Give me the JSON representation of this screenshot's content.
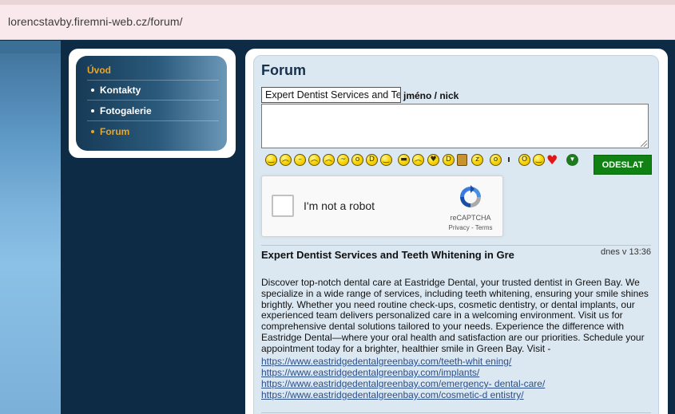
{
  "browser": {
    "url": "lorencstavby.firemni-web.cz/forum/"
  },
  "nav": {
    "home": "Úvod",
    "items": [
      {
        "label": "Kontakty",
        "active": false
      },
      {
        "label": "Fotogalerie",
        "active": false
      },
      {
        "label": "Forum",
        "active": true
      }
    ]
  },
  "forum": {
    "title": "Forum",
    "name_value": "Expert Dentist Services and Teeth Whitening in Gre",
    "name_label": "jméno / nick",
    "message_value": "",
    "send_label": "ODESLAT",
    "smileys": [
      "smile",
      "sad",
      "neutral",
      "worried",
      "crying",
      "confused",
      "surprised",
      "laughing",
      "grin",
      "cool",
      "angry",
      "love-eyes",
      "big-grin",
      "beer-mug",
      "sleepy",
      "whistle",
      "wink",
      "shocked",
      "thinking",
      "heart",
      "more-down"
    ]
  },
  "captcha": {
    "label": "I'm not a robot",
    "brand": "reCAPTCHA",
    "privacy": "Privacy",
    "separator": " - ",
    "terms": "Terms"
  },
  "post": {
    "title": "Expert Dentist Services and Teeth Whitening in Gre",
    "date": "dnes v 13:36",
    "body": "Discover top-notch dental care at Eastridge Dental, your trusted dentist in Green Bay. We specialize in a wide range of services, including teeth whitening, ensuring your smile shines brightly. Whether you need routine check-ups, cosmetic dentistry, or dental implants, our experienced team delivers personalized care in a welcoming environment. Visit us for comprehensive dental solutions tailored to your needs. Experience the difference with Eastridge Dental—where your oral health and satisfaction are our priorities. Schedule your appointment today for a brighter, healthier smile in Green Bay. Visit -",
    "links": [
      "https://www.eastridgedentalgreenbay.com/teeth-whit ening/",
      "https://www.eastridgedentalgreenbay.com/implants/",
      "https://www.eastridgedentalgreenbay.com/emergency- dental-care/",
      "https://www.eastridgedentalgreenbay.com/cosmetic-d entistry/"
    ]
  }
}
